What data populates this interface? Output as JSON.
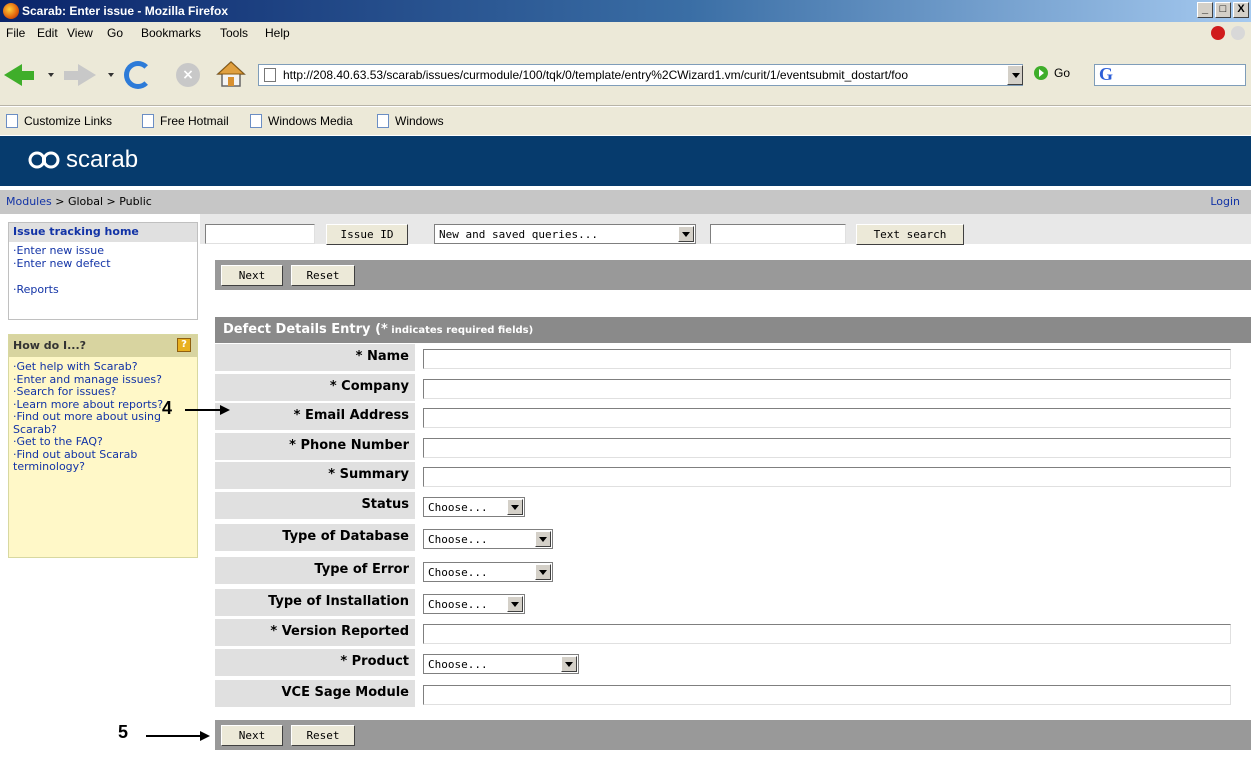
{
  "window": {
    "title": "Scarab: Enter issue - Mozilla Firefox",
    "controls": [
      "_",
      "□",
      "X"
    ]
  },
  "menu": [
    "File",
    "Edit",
    "View",
    "Go",
    "Bookmarks",
    "Tools",
    "Help"
  ],
  "toolbar": {
    "url": "http://208.40.63.53/scarab/issues/curmodule/100/tqk/0/template/entry%2CWizard1.vm/curit/1/eventsubmit_dostart/foo",
    "go_label": "Go",
    "google_label": "G"
  },
  "bookmarks": [
    "Customize Links",
    "Free Hotmail",
    "Windows Media",
    "Windows"
  ],
  "brand": {
    "name": "scarab",
    "color": "#063b6d"
  },
  "breadcrumb": {
    "modules": "Modules",
    "rest": " > Global > Public",
    "login": "Login"
  },
  "sidebar": {
    "home": "Issue tracking home",
    "links": [
      "Enter new issue",
      "Enter new defect",
      "Reports"
    ],
    "howdoi_title": "How do I...?",
    "howdoi_icon": "?",
    "howdoi_links": [
      "Get help with Scarab?",
      "Enter and manage issues?",
      "Search for issues?",
      "Learn more about reports?",
      "Find out more about using Scarab?",
      "Get to the FAQ?",
      "Find out about Scarab terminology?"
    ]
  },
  "search": {
    "issue_id_button": "Issue ID",
    "queries_select": "New and saved queries...",
    "text_search_button": "Text search"
  },
  "actions": {
    "next": "Next",
    "reset": "Reset"
  },
  "form": {
    "title": "Defect Details Entry",
    "note_open": "(*",
    "note_text": " indicates required fields)",
    "fields": [
      {
        "label": "* Name",
        "type": "text",
        "value": ""
      },
      {
        "label": "* Company",
        "type": "text",
        "value": ""
      },
      {
        "label": "* Email Address",
        "type": "text",
        "value": ""
      },
      {
        "label": "* Phone Number",
        "type": "text",
        "value": ""
      },
      {
        "label": "* Summary",
        "type": "text",
        "value": ""
      },
      {
        "label": "Status",
        "type": "select",
        "value": "Choose..."
      },
      {
        "label": "Type of Database",
        "type": "select",
        "value": "Choose..."
      },
      {
        "label": "Type of Error",
        "type": "select",
        "value": "Choose..."
      },
      {
        "label": "Type of Installation",
        "type": "select",
        "value": "Choose..."
      },
      {
        "label": "* Version Reported",
        "type": "text",
        "value": ""
      },
      {
        "label": "* Product",
        "type": "select",
        "value": "Choose..."
      },
      {
        "label": "VCE Sage Module",
        "type": "text",
        "value": ""
      }
    ]
  },
  "annotations": {
    "step4": "4",
    "step5": "5"
  }
}
